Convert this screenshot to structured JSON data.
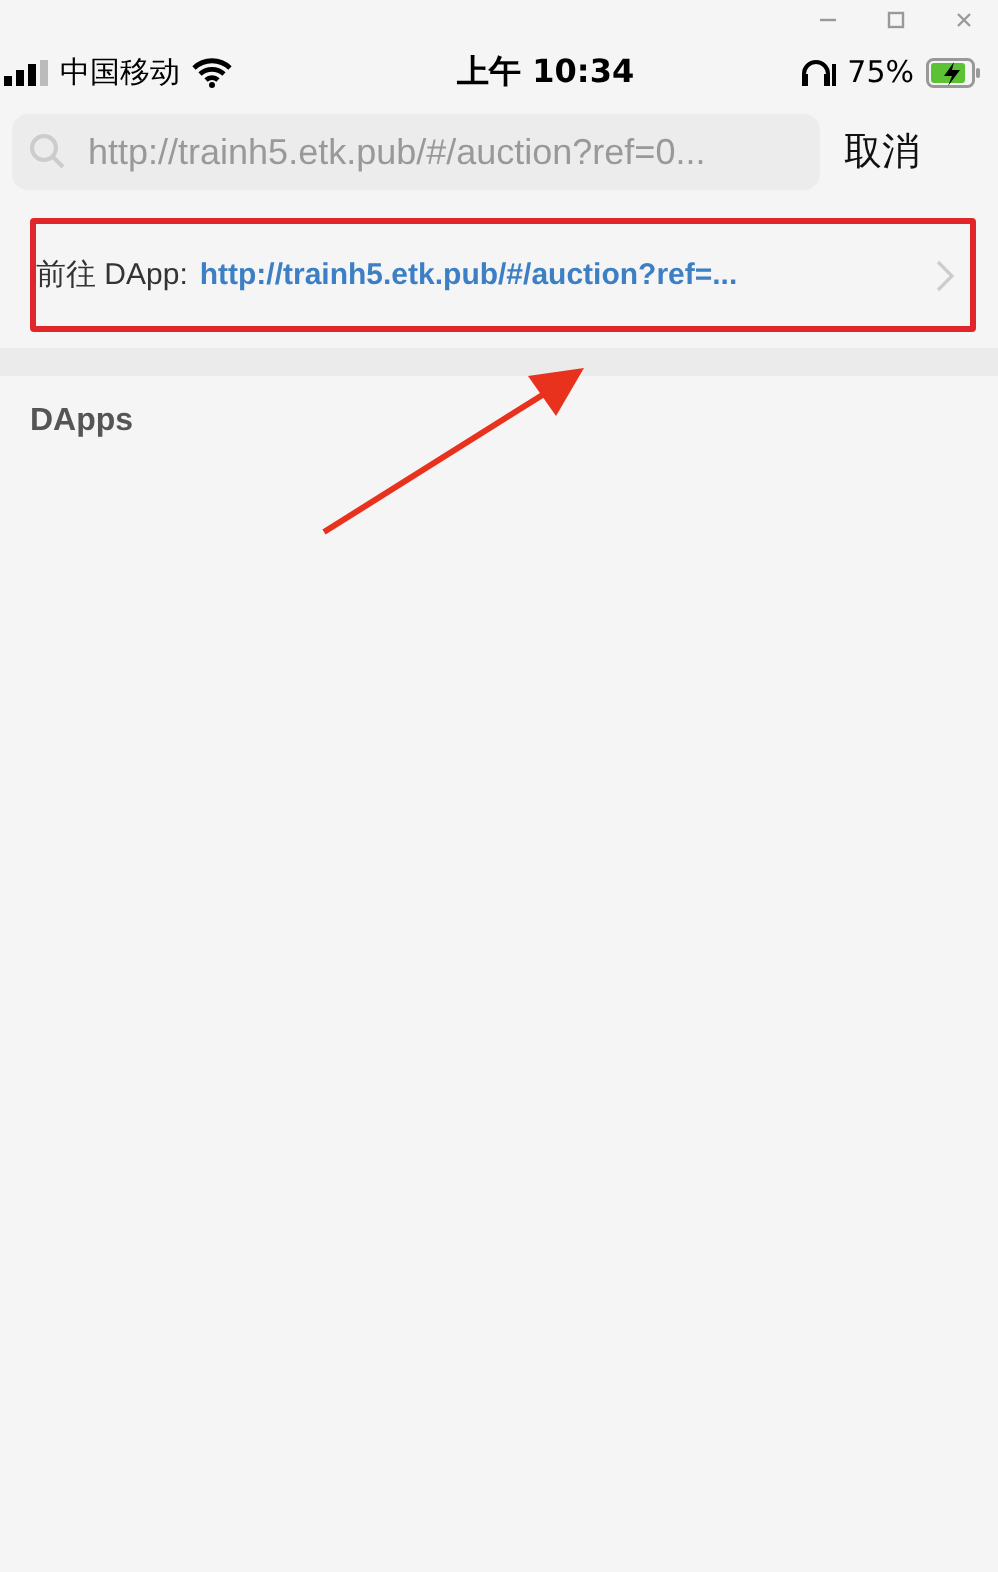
{
  "status_bar": {
    "carrier": "中国移动",
    "time": "上午 10:34",
    "battery": "75%"
  },
  "search": {
    "placeholder": "http://trainh5.etk.pub/#/auction?ref=0...",
    "cancel": "取消"
  },
  "goto_row": {
    "label": "前往 DApp:",
    "url": "http://trainh5.etk.pub/#/auction?ref=...",
    "highlighted": true
  },
  "section": {
    "title": "DApps"
  }
}
